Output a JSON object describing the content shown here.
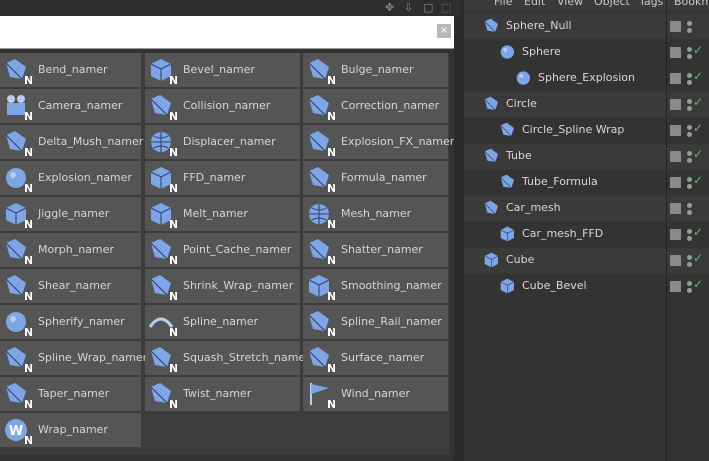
{
  "top_icons": [
    "move-icon",
    "down-arrow-icon",
    "square-icon",
    "expand-icon"
  ],
  "search": {
    "close_glyph": "×"
  },
  "palette": [
    {
      "label": "Bend_namer",
      "icon": "bend-icon"
    },
    {
      "label": "Bevel_namer",
      "icon": "bevel-icon"
    },
    {
      "label": "Bulge_namer",
      "icon": "bulge-icon"
    },
    {
      "label": "Camera_namer",
      "icon": "camera-icon"
    },
    {
      "label": "Collision_namer",
      "icon": "collision-icon"
    },
    {
      "label": "Correction_namer",
      "icon": "correction-icon"
    },
    {
      "label": "Delta_Mush_namer",
      "icon": "delta-mush-icon"
    },
    {
      "label": "Displacer_namer",
      "icon": "displacer-icon"
    },
    {
      "label": "Explosion_FX_namer",
      "icon": "explosion-fx-icon"
    },
    {
      "label": "Explosion_namer",
      "icon": "explosion-icon"
    },
    {
      "label": "FFD_namer",
      "icon": "ffd-icon"
    },
    {
      "label": "Formula_namer",
      "icon": "formula-icon"
    },
    {
      "label": "Jiggle_namer",
      "icon": "jiggle-icon"
    },
    {
      "label": "Melt_namer",
      "icon": "melt-icon"
    },
    {
      "label": "Mesh_namer",
      "icon": "mesh-icon"
    },
    {
      "label": "Morph_namer",
      "icon": "morph-icon"
    },
    {
      "label": "Point_Cache_namer",
      "icon": "point-cache-icon"
    },
    {
      "label": "Shatter_namer",
      "icon": "shatter-icon"
    },
    {
      "label": "Shear_namer",
      "icon": "shear-icon"
    },
    {
      "label": "Shrink_Wrap_namer",
      "icon": "shrink-wrap-icon"
    },
    {
      "label": "Smoothing_namer",
      "icon": "smoothing-icon"
    },
    {
      "label": "Spherify_namer",
      "icon": "spherify-icon"
    },
    {
      "label": "Spline_namer",
      "icon": "spline-icon"
    },
    {
      "label": "Spline_Rail_namer",
      "icon": "spline-rail-icon"
    },
    {
      "label": "Spline_Wrap_namer",
      "icon": "spline-wrap-icon"
    },
    {
      "label": "Squash_Stretch_namer",
      "icon": "squash-stretch-icon"
    },
    {
      "label": "Surface_namer",
      "icon": "surface-icon"
    },
    {
      "label": "Taper_namer",
      "icon": "taper-icon"
    },
    {
      "label": "Twist_namer",
      "icon": "twist-icon"
    },
    {
      "label": "Wind_namer",
      "icon": "wind-icon"
    },
    {
      "label": "Wrap_namer",
      "icon": "wrap-icon"
    }
  ],
  "menu": [
    "File",
    "Edit",
    "View",
    "Object",
    "Tags",
    "Bookm"
  ],
  "objects": [
    {
      "label": "Sphere_Null",
      "icon": "null-icon",
      "depth": 0,
      "enabled": false
    },
    {
      "label": "Sphere",
      "icon": "sphere-icon",
      "depth": 1,
      "enabled": true
    },
    {
      "label": "Sphere_Explosion",
      "icon": "explosion-icon",
      "depth": 2,
      "enabled": true
    },
    {
      "label": "Circle",
      "icon": "circle-icon",
      "depth": 0,
      "enabled": true
    },
    {
      "label": "Circle_Spline Wrap",
      "icon": "spline-wrap-icon",
      "depth": 1,
      "enabled": true
    },
    {
      "label": "Tube",
      "icon": "tube-icon",
      "depth": 0,
      "enabled": true
    },
    {
      "label": "Tube_Formula",
      "icon": "formula-icon",
      "depth": 1,
      "enabled": true
    },
    {
      "label": "Car_mesh",
      "icon": "polygon-icon",
      "depth": 0,
      "enabled": false
    },
    {
      "label": "Car_mesh_FFD",
      "icon": "ffd-icon",
      "depth": 1,
      "enabled": true
    },
    {
      "label": "Cube",
      "icon": "cube-icon",
      "depth": 0,
      "enabled": true
    },
    {
      "label": "Cube_Bevel",
      "icon": "bevel-icon",
      "depth": 1,
      "enabled": true
    }
  ],
  "colors": {
    "accent_blue": "#7ea6e6",
    "enabled_green": "#3fcf4f"
  }
}
